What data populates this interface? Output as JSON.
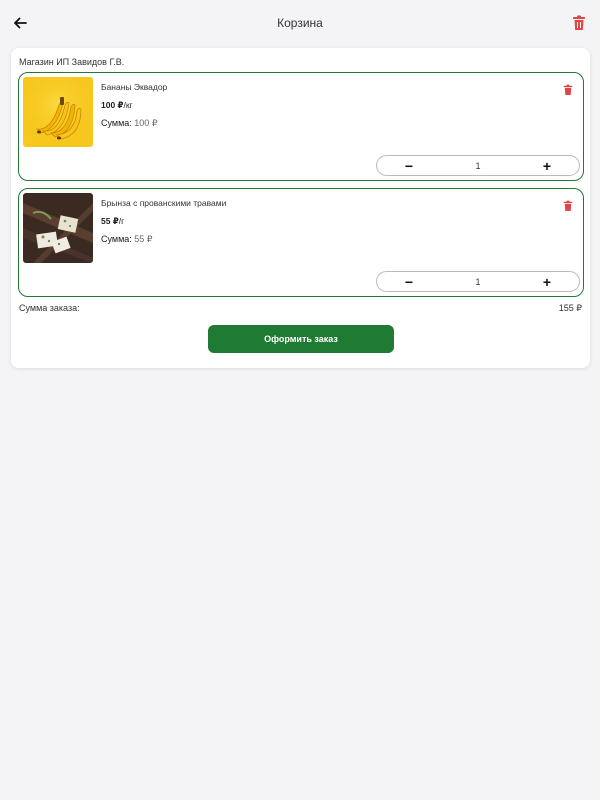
{
  "header": {
    "title": "Корзина",
    "back_icon": "arrow-left-icon",
    "clear_icon": "trash-icon"
  },
  "cart": {
    "store_name": "Магазин ИП Завидов Г.В.",
    "items": [
      {
        "name": "Бананы Эквадор",
        "price": "100 ₽",
        "unit": "/кг",
        "sum_label": "Сумма:",
        "sum_value": "100 ₽",
        "quantity": "1",
        "image": "bananas-image"
      },
      {
        "name": "Брынза с прованскими травами",
        "price": "55 ₽",
        "unit": "/г",
        "sum_label": "Сумма:",
        "sum_value": "55 ₽",
        "quantity": "1",
        "image": "cheese-image"
      }
    ],
    "stepper": {
      "minus": "−",
      "plus": "+"
    },
    "total_label": "Сумма заказа:",
    "total_value": "155 ₽",
    "checkout_label": "Оформить заказ"
  },
  "colors": {
    "accent": "#1f7a34",
    "delete": "#e04646",
    "background": "#f4f4f6"
  }
}
